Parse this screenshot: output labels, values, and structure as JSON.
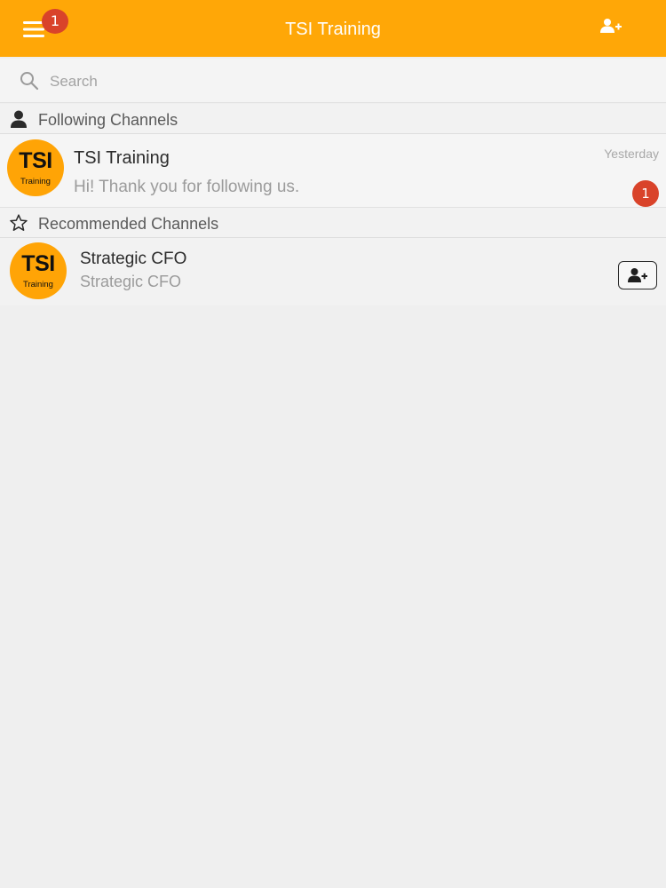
{
  "header": {
    "title": "TSI Training",
    "menu_badge": "1",
    "menu_icon": "hamburger-icon",
    "add_icon": "add-user-icon"
  },
  "search": {
    "placeholder": "Search",
    "value": ""
  },
  "sections": {
    "following": {
      "label": "Following Channels",
      "icon": "person-icon"
    },
    "recommended": {
      "label": "Recommended Channels",
      "icon": "star-icon"
    }
  },
  "following_channels": [
    {
      "avatar_main": "TSI",
      "avatar_sub": "Training",
      "name": "TSI Training",
      "last_message": "Hi! Thank you for following us.",
      "time": "Yesterday",
      "unread": "1"
    }
  ],
  "recommended_channels": [
    {
      "avatar_main": "TSI",
      "avatar_sub": "Training",
      "name": "Strategic CFO",
      "subtitle": "Strategic CFO",
      "action_icon": "add-user-icon"
    }
  ],
  "colors": {
    "brand": "#ffa707",
    "badge": "#d9432a",
    "background": "#efefef"
  }
}
